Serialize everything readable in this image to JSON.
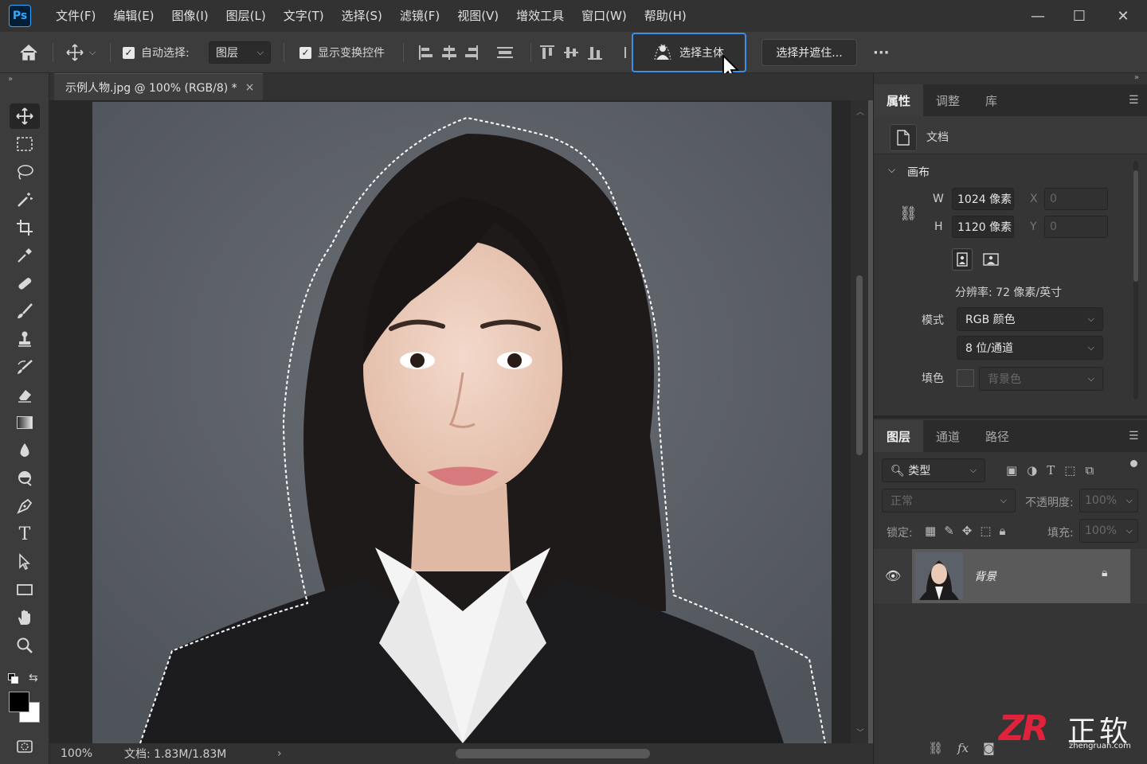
{
  "app": {
    "logo": "Ps"
  },
  "menu": [
    "文件(F)",
    "编辑(E)",
    "图像(I)",
    "图层(L)",
    "文字(T)",
    "选择(S)",
    "滤镜(F)",
    "视图(V)",
    "增效工具",
    "窗口(W)",
    "帮助(H)"
  ],
  "window_controls": {
    "minimize": "—",
    "maximize": "☐",
    "close": "✕"
  },
  "options": {
    "auto_select_label": "自动选择:",
    "auto_select_checked": true,
    "auto_select_target": "图层",
    "show_transform_label": "显示变换控件",
    "show_transform_checked": true,
    "select_subject": "选择主体",
    "select_and_mask": "选择并遮住...",
    "more": "···"
  },
  "document": {
    "tab_title": "示例人物.jpg @ 100% (RGB/8) *",
    "close": "×",
    "zoom": "100%",
    "doc_info": "文档: 1.83M/1.83M",
    "status_arrow": "›"
  },
  "properties_panel": {
    "tabs": [
      "属性",
      "调整",
      "库"
    ],
    "active_tab": "属性",
    "doc_label": "文档",
    "section": "画布",
    "w_label": "W",
    "w_value": "1024 像素",
    "h_label": "H",
    "h_value": "1120 像素",
    "x_label": "X",
    "x_value": "0",
    "y_label": "Y",
    "y_value": "0",
    "resolution": "分辨率: 72 像素/英寸",
    "mode_label": "模式",
    "mode_value": "RGB 颜色",
    "depth_value": "8 位/通道",
    "fill_label": "填色",
    "fill_value": "背景色"
  },
  "layers_panel": {
    "tabs": [
      "图层",
      "通道",
      "路径"
    ],
    "active_tab": "图层",
    "filter_label": "类型",
    "blend_mode": "正常",
    "opacity_label": "不透明度:",
    "opacity_value": "100%",
    "lock_label": "锁定:",
    "fill_label": "填充:",
    "fill_value": "100%",
    "layers": [
      {
        "name": "背景",
        "visible": true,
        "locked": true
      }
    ],
    "footer_fx": "fx"
  },
  "watermark": {
    "logo": "ZR",
    "name": "正软",
    "url": "zhengruan.com"
  },
  "colors": {
    "accent": "#3d8ee6",
    "ps_blue": "#31a8ff",
    "canvas_bg": "#5a5e66"
  }
}
